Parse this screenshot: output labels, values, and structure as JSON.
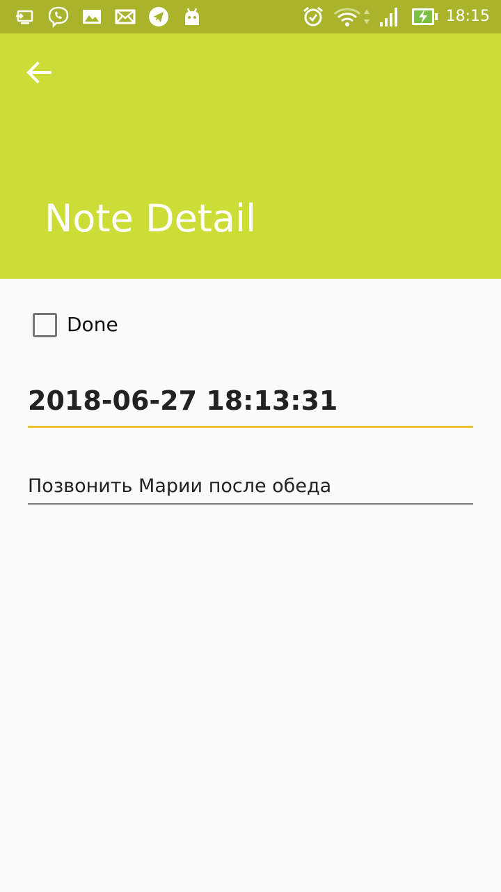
{
  "status_bar": {
    "time": "18:15",
    "left_icons": [
      "cast-screen-icon",
      "viber-icon",
      "image-icon",
      "mail-icon",
      "telegram-icon",
      "android-icon"
    ],
    "right_icons": [
      "alarm-icon",
      "wifi-icon",
      "signal-icon",
      "battery-charging-icon"
    ],
    "background": "#a9b32c"
  },
  "app_bar": {
    "title": "Note Detail",
    "back_icon": "arrow-back-icon",
    "background": "#cddd38"
  },
  "form": {
    "done_label": "Done",
    "done_checked": false,
    "date_value": "2018-06-27 18:13:31",
    "date_underline_color": "#f2c12e",
    "note_value": "Позвонить Марии после обеда"
  }
}
